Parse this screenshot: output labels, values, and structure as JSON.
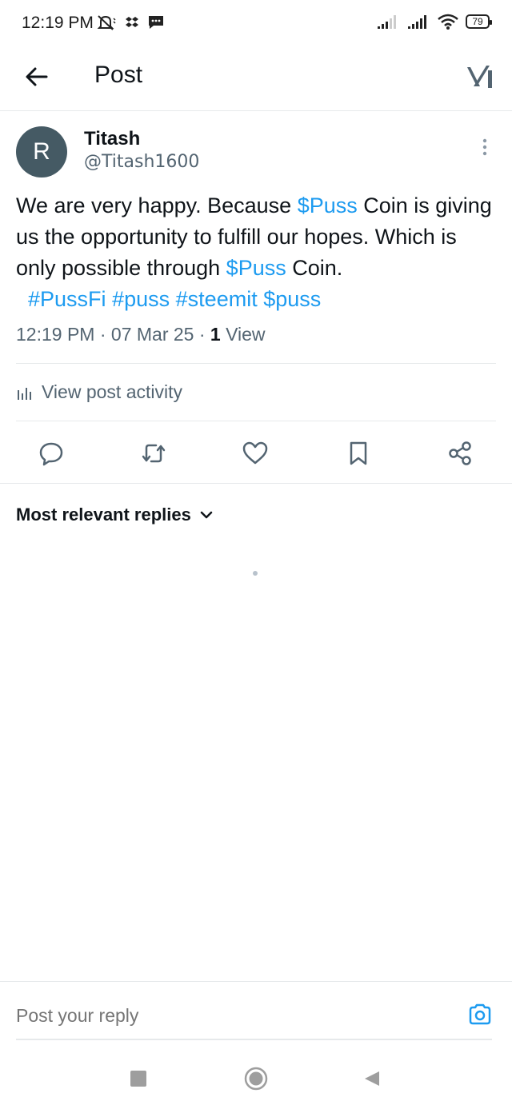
{
  "status_bar": {
    "time": "12:19 PM",
    "battery": "79",
    "icons": [
      "mute-icon",
      "dropbox-icon",
      "message-icon",
      "signal-icon",
      "signal-icon",
      "wifi-icon",
      "battery-icon"
    ]
  },
  "header": {
    "title": "Post",
    "back_icon": "arrow-left-icon",
    "logo_icon": "x-logo-icon"
  },
  "post": {
    "avatar_letter": "R",
    "avatar_color": "#455a64",
    "name": "Titash",
    "handle": "@Titash1600",
    "text_1": "We are very happy. Because ",
    "cashtag_1": "$Puss",
    "text_2": " Coin is giving us the opportunity to fulfill our hopes. Which is only possible through ",
    "cashtag_2": "$Puss",
    "text_3": " Coin.",
    "tag_1": "#PussFi",
    "tag_2": "#puss",
    "tag_3": "#steemit",
    "tag_4": "$puss",
    "time": "12:19 PM",
    "date": "07 Mar 25",
    "views_count": "1",
    "views_label": "View",
    "link_color": "#1d9bf0"
  },
  "activity": {
    "label": "View post activity"
  },
  "replies": {
    "sort_label": "Most relevant replies"
  },
  "reply_box": {
    "placeholder": "Post your reply"
  }
}
